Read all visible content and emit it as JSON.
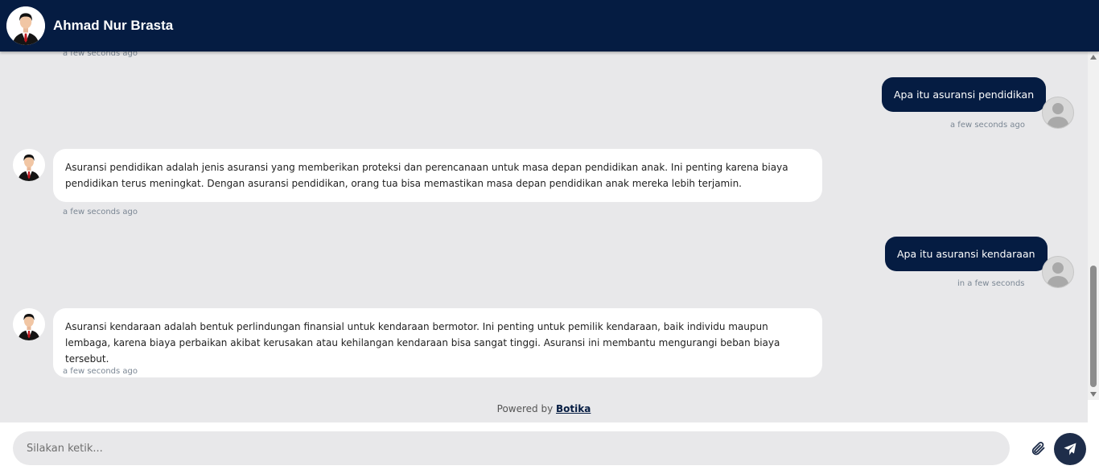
{
  "header": {
    "title": "Ahmad Nur Brasta",
    "avatar_icon": "businessman-avatar-icon"
  },
  "messages": [
    {
      "from": "bot",
      "timestamp": "a few seconds ago"
    },
    {
      "from": "user",
      "text": "Apa itu asuransi pendidikan",
      "timestamp": "a few seconds ago"
    },
    {
      "from": "bot",
      "text": "Asuransi pendidikan adalah jenis asuransi yang memberikan proteksi dan perencanaan untuk masa depan pendidikan anak. Ini penting karena biaya pendidikan terus meningkat. Dengan asuransi pendidikan, orang tua bisa memastikan masa depan pendidikan anak mereka lebih terjamin.",
      "timestamp": "a few seconds ago"
    },
    {
      "from": "user",
      "text": "Apa itu asuransi kendaraan",
      "timestamp": "in a few seconds"
    },
    {
      "from": "bot",
      "text": "Asuransi kendaraan adalah bentuk perlindungan finansial untuk kendaraan bermotor. Ini penting untuk pemilik kendaraan, baik individu maupun lembaga, karena biaya perbaikan akibat kerusakan atau kehilangan kendaraan bisa sangat tinggi. Asuransi ini membantu mengurangi beban biaya tersebut.",
      "timestamp": "a few seconds ago"
    }
  ],
  "powered_by": {
    "prefix": "Powered by",
    "brand": "Botika"
  },
  "composer": {
    "placeholder": "Silakan ketik...",
    "value": ""
  },
  "colors": {
    "primary": "#051c42",
    "chat_background": "#e8e8ea",
    "bubble_bot": "#ffffff",
    "send_button": "#1e2d4a"
  }
}
